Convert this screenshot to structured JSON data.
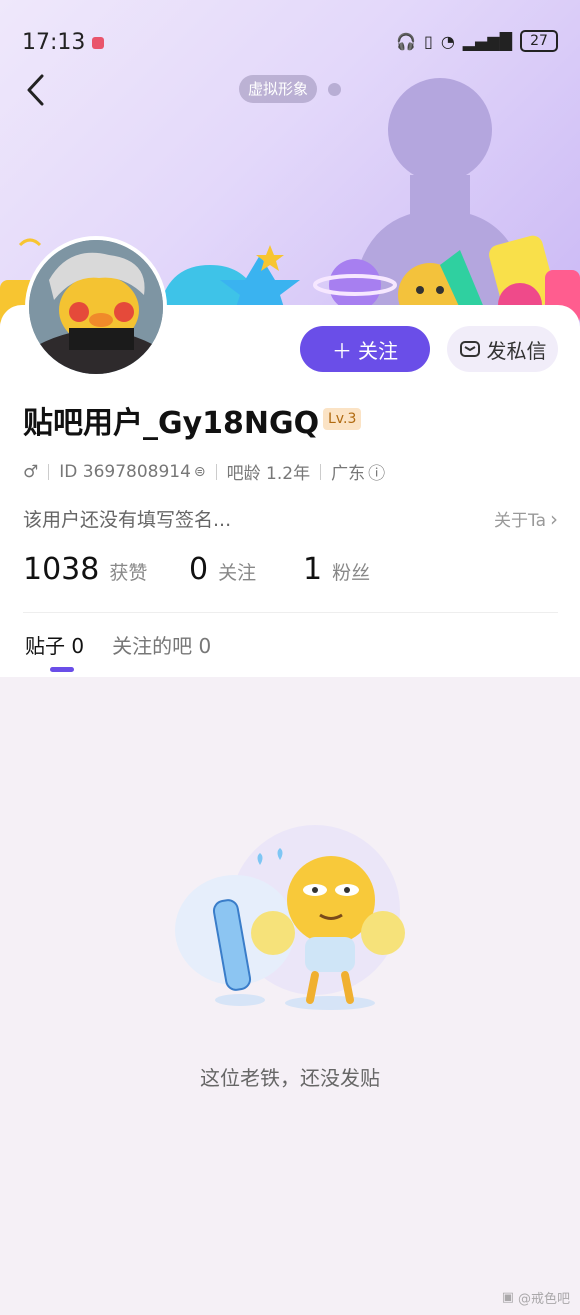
{
  "status_bar": {
    "time": "17:13",
    "battery": "27"
  },
  "header": {
    "avatar_tag": "虚拟形象"
  },
  "profile": {
    "username": "贴吧用户_Gy18NGQ",
    "level": "Lv.3",
    "gender_icon": "male-icon",
    "id_text": "ID 3697808914",
    "bar_age": "吧龄 1.2年",
    "location": "广东",
    "signature": "该用户还没有填写签名...",
    "about_label": "关于Ta"
  },
  "actions": {
    "follow_label": "关注",
    "message_label": "发私信"
  },
  "stats": [
    {
      "value": "1038",
      "label": "获赞"
    },
    {
      "value": "0",
      "label": "关注"
    },
    {
      "value": "1",
      "label": "粉丝"
    }
  ],
  "tabs": [
    {
      "label": "贴子",
      "count": "0",
      "active": true
    },
    {
      "label": "关注的吧",
      "count": "0",
      "active": false
    }
  ],
  "empty_state": {
    "message": "这位老铁，还没发贴"
  },
  "watermark": "@戒色吧",
  "colors": {
    "accent": "#6a4ee8",
    "level_bg": "#fbe3c5"
  }
}
